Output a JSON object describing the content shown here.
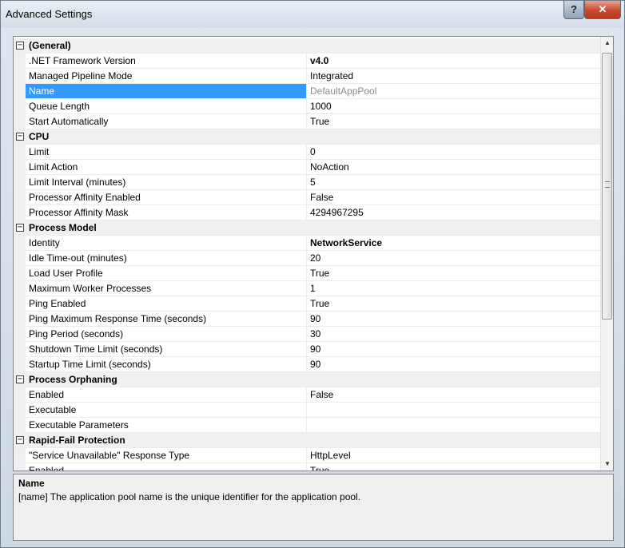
{
  "window": {
    "title": "Advanced Settings",
    "help_label": "?",
    "close_label": "✕"
  },
  "grid": {
    "rows": [
      {
        "type": "category",
        "label": "(General)",
        "toggle": "⊟"
      },
      {
        "type": "prop",
        "label": ".NET Framework Version",
        "value": "v4.0",
        "bold": true
      },
      {
        "type": "prop",
        "label": "Managed Pipeline Mode",
        "value": "Integrated"
      },
      {
        "type": "prop",
        "label": "Name",
        "value": "DefaultAppPool",
        "selected": true,
        "dim": true
      },
      {
        "type": "prop",
        "label": "Queue Length",
        "value": "1000"
      },
      {
        "type": "prop",
        "label": "Start Automatically",
        "value": "True"
      },
      {
        "type": "category",
        "label": "CPU",
        "toggle": "⊟"
      },
      {
        "type": "prop",
        "label": "Limit",
        "value": "0"
      },
      {
        "type": "prop",
        "label": "Limit Action",
        "value": "NoAction"
      },
      {
        "type": "prop",
        "label": "Limit Interval (minutes)",
        "value": "5"
      },
      {
        "type": "prop",
        "label": "Processor Affinity Enabled",
        "value": "False"
      },
      {
        "type": "prop",
        "label": "Processor Affinity Mask",
        "value": "4294967295"
      },
      {
        "type": "category",
        "label": "Process Model",
        "toggle": "⊟"
      },
      {
        "type": "prop",
        "label": "Identity",
        "value": "NetworkService",
        "bold": true
      },
      {
        "type": "prop",
        "label": "Idle Time-out (minutes)",
        "value": "20"
      },
      {
        "type": "prop",
        "label": "Load User Profile",
        "value": "True"
      },
      {
        "type": "prop",
        "label": "Maximum Worker Processes",
        "value": "1"
      },
      {
        "type": "prop",
        "label": "Ping Enabled",
        "value": "True"
      },
      {
        "type": "prop",
        "label": "Ping Maximum Response Time (seconds)",
        "value": "90"
      },
      {
        "type": "prop",
        "label": "Ping Period (seconds)",
        "value": "30"
      },
      {
        "type": "prop",
        "label": "Shutdown Time Limit (seconds)",
        "value": "90"
      },
      {
        "type": "prop",
        "label": "Startup Time Limit (seconds)",
        "value": "90"
      },
      {
        "type": "category",
        "label": "Process Orphaning",
        "toggle": "⊟"
      },
      {
        "type": "prop",
        "label": "Enabled",
        "value": "False"
      },
      {
        "type": "prop",
        "label": "Executable",
        "value": ""
      },
      {
        "type": "prop",
        "label": "Executable Parameters",
        "value": ""
      },
      {
        "type": "category",
        "label": "Rapid-Fail Protection",
        "toggle": "⊟"
      },
      {
        "type": "prop",
        "label": "\"Service Unavailable\" Response Type",
        "value": "HttpLevel"
      },
      {
        "type": "prop",
        "label": "Enabled",
        "value": "True"
      }
    ],
    "scrollbar": {
      "up_icon": "▲",
      "down_icon": "▼"
    }
  },
  "description": {
    "title": "Name",
    "text": "[name] The application pool name is the unique identifier for the application pool."
  }
}
